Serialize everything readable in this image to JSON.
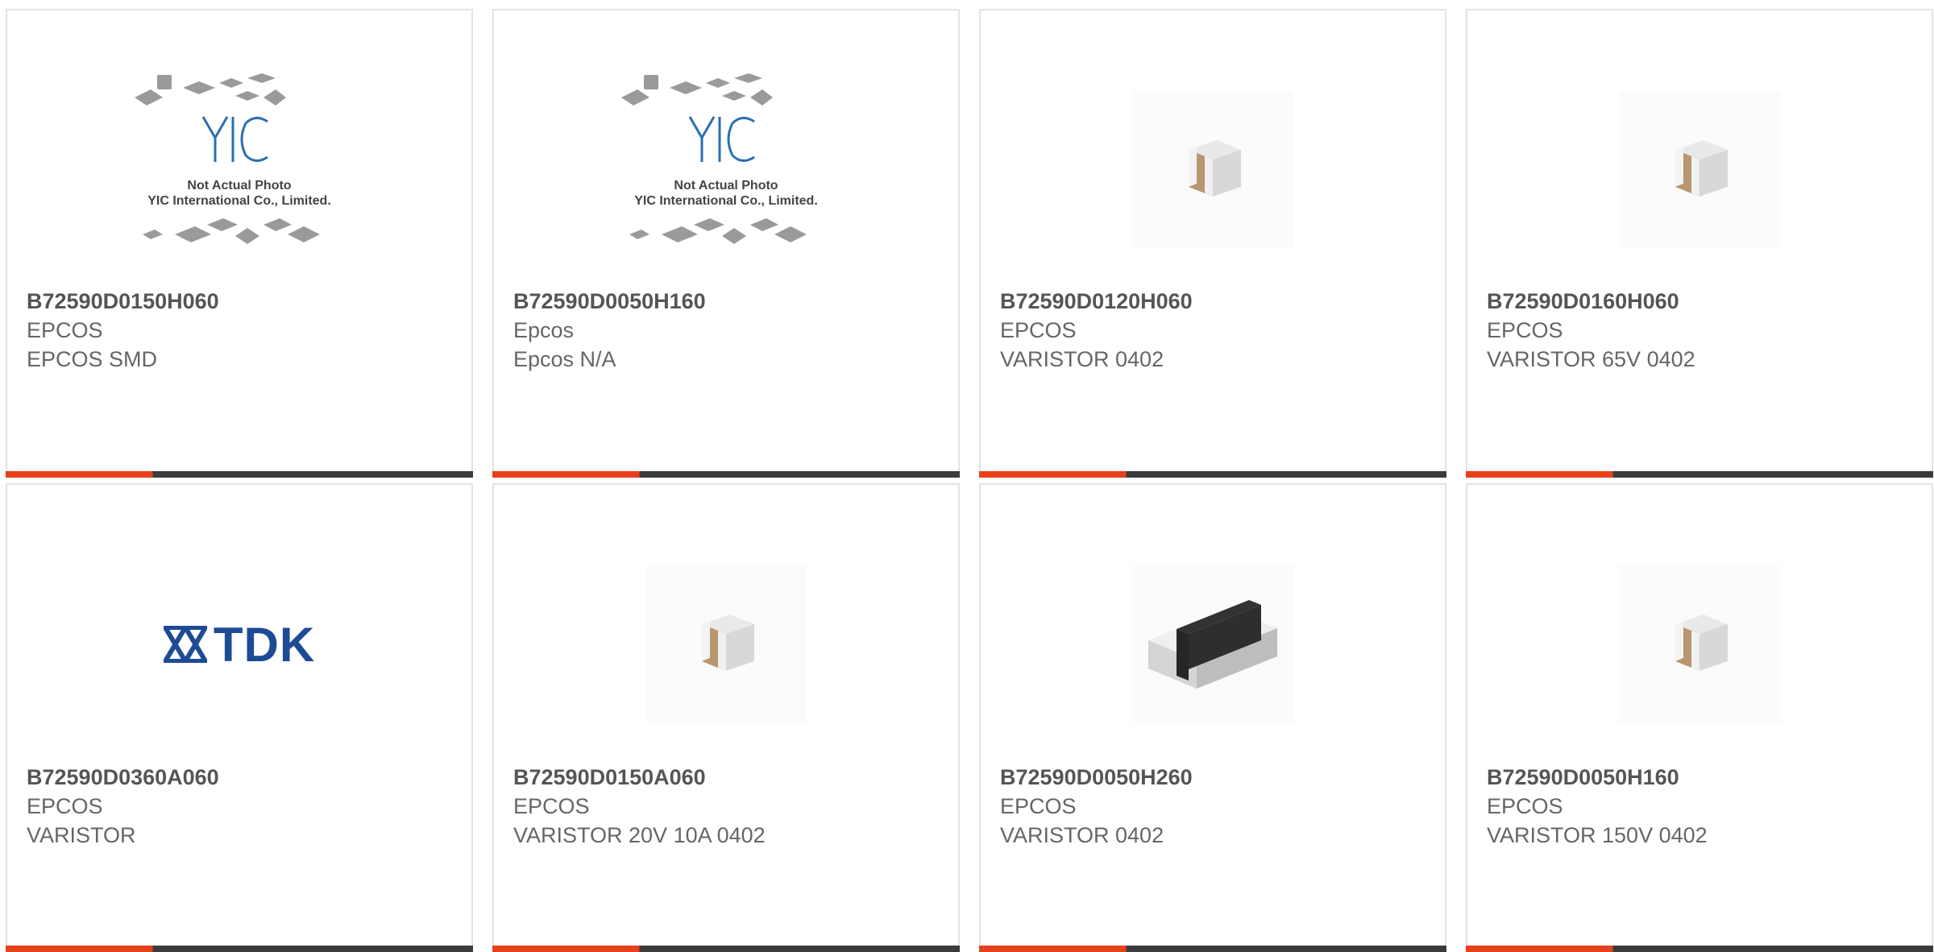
{
  "cards": [
    {
      "part": "B72590D0150H060",
      "manufacturer": "EPCOS",
      "description": "EPCOS SMD",
      "image": "yic-placeholder",
      "image_note_1": "Not Actual Photo",
      "image_note_2": "YIC International Co., Limited.",
      "image_logo": "YIC"
    },
    {
      "part": "B72590D0050H160",
      "manufacturer": "Epcos",
      "description": "Epcos N/A",
      "image": "yic-placeholder",
      "image_note_1": "Not Actual Photo",
      "image_note_2": "YIC International Co., Limited.",
      "image_logo": "YIC"
    },
    {
      "part": "B72590D0120H060",
      "manufacturer": "EPCOS",
      "description": "VARISTOR 0402",
      "image": "chip-brown"
    },
    {
      "part": "B72590D0160H060",
      "manufacturer": "EPCOS",
      "description": "VARISTOR 65V 0402",
      "image": "chip-brown"
    },
    {
      "part": "B72590D0360A060",
      "manufacturer": "EPCOS",
      "description": "VARISTOR",
      "image": "tdk-logo",
      "image_logo": "TDK"
    },
    {
      "part": "B72590D0150A060",
      "manufacturer": "EPCOS",
      "description": "VARISTOR 20V 10A 0402",
      "image": "chip-brown"
    },
    {
      "part": "B72590D0050H260",
      "manufacturer": "EPCOS",
      "description": "VARISTOR 0402",
      "image": "chip-black"
    },
    {
      "part": "B72590D0050H160",
      "manufacturer": "EPCOS",
      "description": "VARISTOR 150V 0402",
      "image": "chip-brown"
    }
  ],
  "colors": {
    "accent": "#e8401c",
    "bar_dark": "#3b3b3b",
    "tdk_blue": "#1e4b95",
    "yic_blue": "#2a6fb4"
  }
}
